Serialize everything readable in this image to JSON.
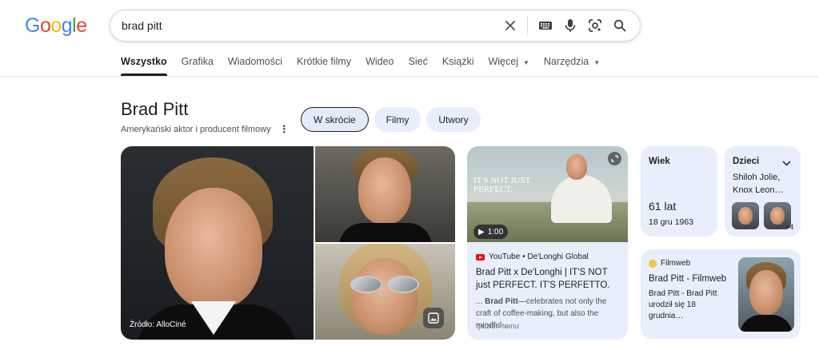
{
  "logo": "Google",
  "search": {
    "query": "brad pitt"
  },
  "tabs": [
    {
      "label": "Wszystko",
      "active": true
    },
    {
      "label": "Grafika"
    },
    {
      "label": "Wiadomości"
    },
    {
      "label": "Krótkie filmy"
    },
    {
      "label": "Wideo"
    },
    {
      "label": "Sieć"
    },
    {
      "label": "Książki"
    },
    {
      "label": "Więcej",
      "dropdown": true
    },
    {
      "label": "Narzędzia",
      "dropdown": true
    }
  ],
  "entity": {
    "title": "Brad Pitt",
    "subtitle": "Amerykański aktor i producent filmowy",
    "chips": [
      "W skrócie",
      "Filmy",
      "Utwory"
    ]
  },
  "images": {
    "source": "Źródło: AlloCiné"
  },
  "video": {
    "thumb_text_1": "IT'S NOT JUST",
    "thumb_text_2": "PERFECT.",
    "duration": "1:00",
    "source": "YouTube • De'Longhi Global",
    "title": "Brad Pitt x De'Longhi | IT'S NOT just PERFECT. IT'S PERFETTO.",
    "snippet_prefix": "... ",
    "snippet_bold": "Brad Pitt",
    "snippet_rest": "—celebrates not only the craft of coffee-making, but also the mindful ...",
    "time": "tydzień temu"
  },
  "age_card": {
    "label": "Wiek",
    "value": "61 lat",
    "date": "18 gru 1963"
  },
  "kids_card": {
    "label": "Dzieci",
    "names": "Shiloh Jolie, Knox Leon…",
    "more": "+4"
  },
  "filmweb_card": {
    "source": "Filmweb",
    "title": "Brad Pitt - Filmweb",
    "snippet": "Brad Pitt - Brad Pitt urodził się 18 grudnia…"
  },
  "colors": {
    "card_bg": "#e8eefb",
    "accent_blue": "#4285f4"
  }
}
